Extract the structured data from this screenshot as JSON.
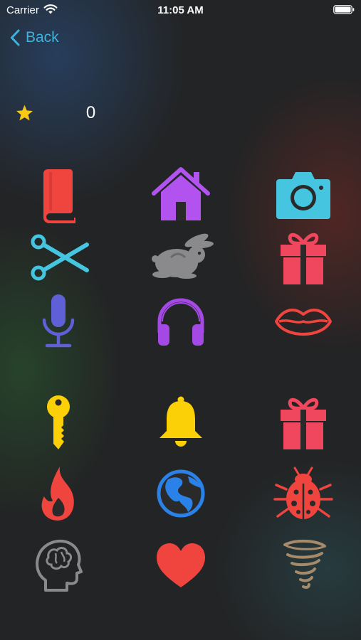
{
  "status_bar": {
    "carrier": "Carrier",
    "time": "11:05 AM"
  },
  "nav": {
    "back_label": "Back"
  },
  "score": {
    "icon": "star-icon",
    "value": "0",
    "star_color": "#f7c917"
  },
  "colors": {
    "accent": "#3cb3dd",
    "red": "#f0453f",
    "purple": "#b253f0",
    "cyan": "#45c5e0",
    "gray": "#8a8a8c",
    "pink": "#f0475e",
    "indigo": "#5f5fd6",
    "violet": "#a449e6",
    "yellow": "#fbd006",
    "blue": "#2a82e8",
    "tan": "#a68a6a",
    "background": "#232425"
  },
  "grid": {
    "rows": [
      [
        "book-icon",
        "house-icon",
        "camera-icon"
      ],
      [
        "scissors-icon",
        "hare-icon",
        "gift-icon"
      ],
      [
        "microphone-icon",
        "headphones-icon",
        "lips-icon"
      ],
      [
        "key-icon",
        "bell-icon",
        "gift-icon"
      ],
      [
        "flame-icon",
        "globe-icon",
        "ladybug-icon"
      ],
      [
        "brain-head-icon",
        "heart-icon",
        "tornado-icon"
      ]
    ]
  }
}
